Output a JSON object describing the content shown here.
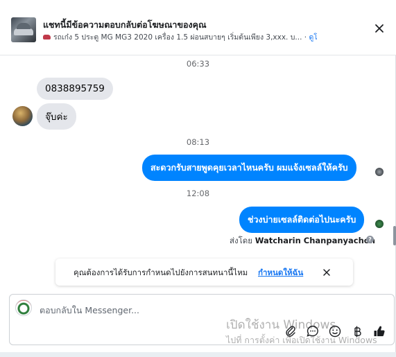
{
  "header": {
    "title": "แชทนี้มีข้อความตอบกลับต่อโฆษณาของคุณ",
    "subtitle": "รถเก๋ง 5 ประตู MG MG3 2020 เครื่อง 1.5 ผ่อนสบายๆ เริ่มต้นเพียง 3,xxx. บ...",
    "separator": " · ",
    "ad_link": "ดูโฆษณา",
    "close_icon": "close-icon"
  },
  "messages": {
    "ts1": "06:33",
    "in1": "0838895759",
    "in2": "จุ๊บค่ะ",
    "ts2": "08:13",
    "out1": "สะดวกรับสายพูดคุยเวลาไหนครับ ผมแจ้งเซลล์ให้ครับ",
    "ts3": "12:08",
    "out2": "ช่วงบ่ายเซลล์ติดต่อไปนะครับ"
  },
  "sent_by": {
    "prefix": "ส่งโดย",
    "name": "Watcharin Chanpanyachon"
  },
  "notice": {
    "text": "คุณต้องการได้รับการกำหนดไปยังการสนทนานี้ไหม",
    "link": "กำหนดให้ฉัน"
  },
  "composer": {
    "placeholder": "ตอบกลับใน Messenger..."
  },
  "watermark": {
    "line1": "เปิดใช้งาน Windows",
    "line2": "ไปที่ การตั้งค่า เพื่อเปิดใช้งาน Windows"
  },
  "colors": {
    "outgoing": "#0084ff",
    "incoming": "#e4e6eb",
    "link": "#1877f2"
  },
  "icons": [
    "paperclip-icon",
    "chat-bubble-icon",
    "emoji-icon",
    "baht-icon",
    "thumbs-up-icon"
  ]
}
